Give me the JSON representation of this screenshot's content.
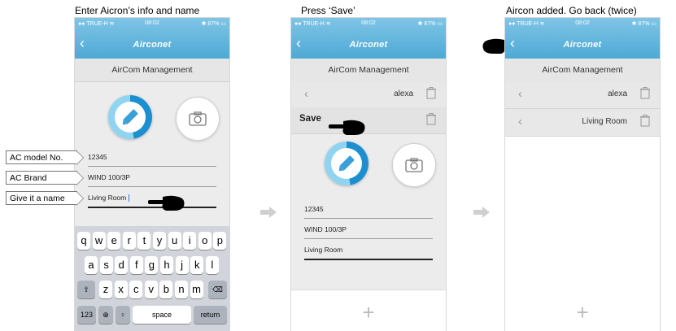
{
  "captions": {
    "step1": "Enter Aicron’s info and name",
    "step2": "Press ‘Save’",
    "step3": "Aircon added. Go back (twice)"
  },
  "status": {
    "carrier": "TRUE-H",
    "time": "08:02",
    "battery": "87%"
  },
  "app": {
    "logo": "Airconet",
    "page_title": "AirCom Management",
    "back_glyph": "‹"
  },
  "screen1": {
    "fields": [
      {
        "value": "12345"
      },
      {
        "value": "WIND 100/3P"
      },
      {
        "value": "Living Room"
      }
    ],
    "keyboard": {
      "row1": [
        "q",
        "w",
        "e",
        "r",
        "t",
        "y",
        "u",
        "i",
        "o",
        "p"
      ],
      "row2": [
        "a",
        "s",
        "d",
        "f",
        "g",
        "h",
        "j",
        "k",
        "l"
      ],
      "row3": [
        "z",
        "x",
        "c",
        "v",
        "b",
        "n",
        "m"
      ],
      "numbers_key": "123",
      "space_key": "space",
      "return_key": "return"
    }
  },
  "screen2": {
    "rows": [
      {
        "label": "alexa"
      }
    ],
    "save_label": "Save",
    "fields": [
      {
        "value": "12345"
      },
      {
        "value": "WIND 100/3P"
      },
      {
        "value": "Living Room"
      }
    ],
    "add_glyph": "+"
  },
  "screen3": {
    "rows": [
      {
        "label": "alexa"
      },
      {
        "label": "Living Room"
      }
    ],
    "add_glyph": "+"
  },
  "callouts": {
    "model": "AC model No.",
    "brand": "AC Brand",
    "name": "Give it a name"
  },
  "colors": {
    "header_gradient_top": "#7fc5e6",
    "header_gradient_bottom": "#4ea9d6",
    "accent": "#1c8fd1",
    "background_grey": "#ececec"
  }
}
